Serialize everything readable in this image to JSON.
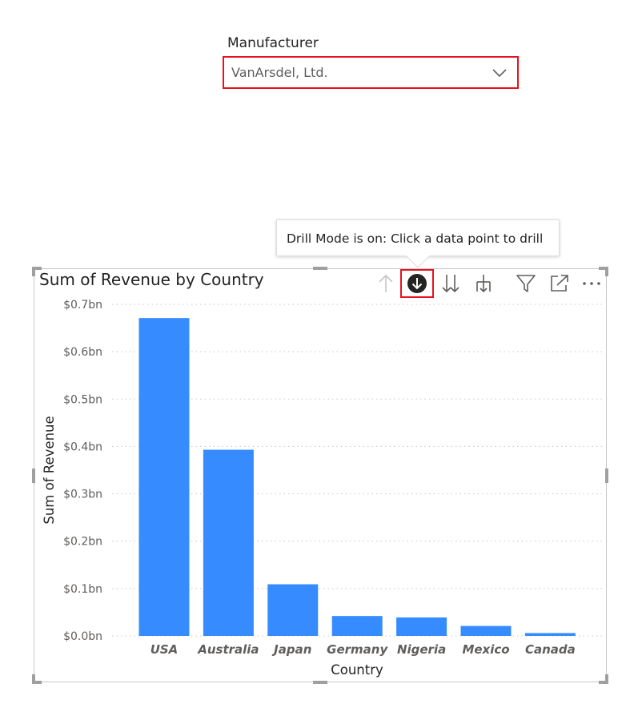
{
  "slicer": {
    "title": "Manufacturer",
    "selected_value": "VanArsdel, Ltd.",
    "highlight_color": "#e8111d",
    "icon": "chevron-down-icon"
  },
  "tooltip": {
    "text": "Drill Mode is on: Click a data point to drill"
  },
  "visual": {
    "title": "Sum of Revenue by Country",
    "header_icons": [
      "drill-up-icon",
      "drill-down-mode-icon",
      "go-to-next-level-icon",
      "expand-hierarchy-icon",
      "filter-icon",
      "focus-mode-icon",
      "more-options-icon"
    ],
    "drill_mode_active": true
  },
  "chart_data": {
    "type": "bar",
    "title": "Sum of Revenue by Country",
    "xlabel": "Country",
    "ylabel": "Sum of Revenue",
    "categories": [
      "USA",
      "Australia",
      "Japan",
      "Germany",
      "Nigeria",
      "Mexico",
      "Canada"
    ],
    "values": [
      0.671,
      0.393,
      0.109,
      0.042,
      0.039,
      0.021,
      0.006
    ],
    "value_unit": "billions",
    "ylim": [
      0,
      0.7
    ],
    "yticks": [
      0,
      0.1,
      0.2,
      0.3,
      0.4,
      0.5,
      0.6,
      0.7
    ],
    "ytick_labels": [
      "$0.0bn",
      "$0.1bn",
      "$0.2bn",
      "$0.3bn",
      "$0.4bn",
      "$0.5bn",
      "$0.6bn",
      "$0.7bn"
    ],
    "grid": true,
    "bar_color": "#368cff"
  }
}
